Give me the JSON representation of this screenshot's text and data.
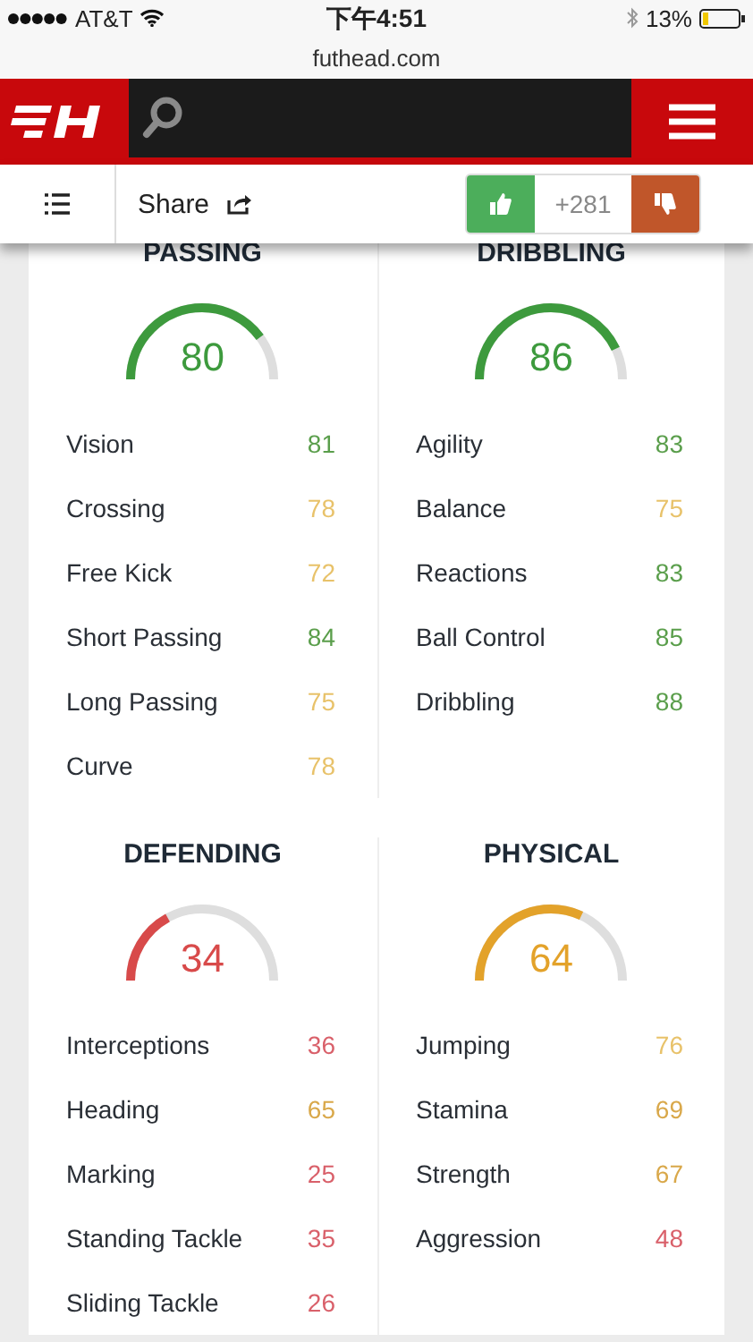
{
  "status_bar": {
    "carrier": "AT&T",
    "time": "下午4:51",
    "battery": "13%"
  },
  "url": "futhead.com",
  "toolbar": {
    "share": "Share",
    "votes": "+281"
  },
  "sections": [
    {
      "title": "PASSING",
      "rating": "80",
      "color": "#3d9a3d",
      "stats": [
        {
          "name": "Vision",
          "value": "81",
          "color": "#5a9e4b"
        },
        {
          "name": "Crossing",
          "value": "78",
          "color": "#e8c26a"
        },
        {
          "name": "Free Kick",
          "value": "72",
          "color": "#e8c26a"
        },
        {
          "name": "Short Passing",
          "value": "84",
          "color": "#5a9e4b"
        },
        {
          "name": "Long Passing",
          "value": "75",
          "color": "#e8c26a"
        },
        {
          "name": "Curve",
          "value": "78",
          "color": "#e8c26a"
        }
      ]
    },
    {
      "title": "DRIBBLING",
      "rating": "86",
      "color": "#3d9a3d",
      "stats": [
        {
          "name": "Agility",
          "value": "83",
          "color": "#5a9e4b"
        },
        {
          "name": "Balance",
          "value": "75",
          "color": "#e8c26a"
        },
        {
          "name": "Reactions",
          "value": "83",
          "color": "#5a9e4b"
        },
        {
          "name": "Ball Control",
          "value": "85",
          "color": "#5a9e4b"
        },
        {
          "name": "Dribbling",
          "value": "88",
          "color": "#5a9e4b"
        }
      ]
    },
    {
      "title": "DEFENDING",
      "rating": "34",
      "color": "#d84a4a",
      "stats": [
        {
          "name": "Interceptions",
          "value": "36",
          "color": "#d9606a"
        },
        {
          "name": "Heading",
          "value": "65",
          "color": "#d9a84a"
        },
        {
          "name": "Marking",
          "value": "25",
          "color": "#d9606a"
        },
        {
          "name": "Standing Tackle",
          "value": "35",
          "color": "#d9606a"
        },
        {
          "name": "Sliding Tackle",
          "value": "26",
          "color": "#d9606a"
        }
      ]
    },
    {
      "title": "PHYSICAL",
      "rating": "64",
      "color": "#e3a22a",
      "stats": [
        {
          "name": "Jumping",
          "value": "76",
          "color": "#e8c26a"
        },
        {
          "name": "Stamina",
          "value": "69",
          "color": "#d9a84a"
        },
        {
          "name": "Strength",
          "value": "67",
          "color": "#d9a84a"
        },
        {
          "name": "Aggression",
          "value": "48",
          "color": "#d9606a"
        }
      ]
    }
  ]
}
